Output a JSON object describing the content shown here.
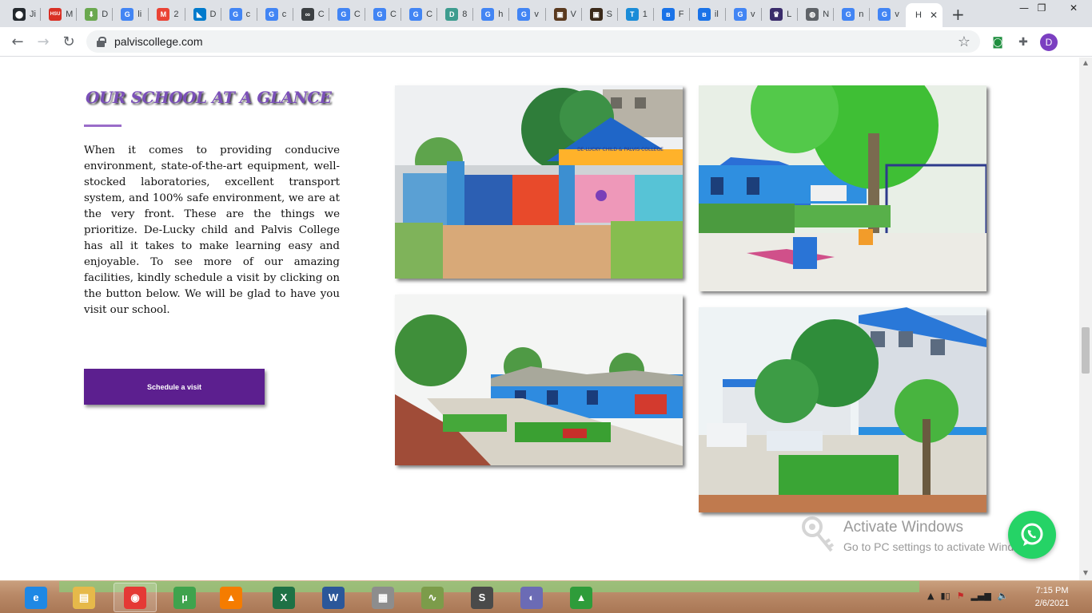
{
  "browser": {
    "tabs": [
      {
        "icon": "github-icon",
        "title": "Ji",
        "color": "#24292e",
        "glyph": "⬤"
      },
      {
        "icon": "hsu-icon",
        "title": "M",
        "color": "#d93025",
        "glyph": "HSU"
      },
      {
        "icon": "download-icon",
        "title": "D",
        "color": "#6aa84f",
        "glyph": "⬇"
      },
      {
        "icon": "google-icon",
        "title": "li",
        "color": "#4285f4",
        "glyph": "G"
      },
      {
        "icon": "gmail-icon",
        "title": "2",
        "color": "#ea4335",
        "glyph": "M"
      },
      {
        "icon": "vscode-icon",
        "title": "D",
        "color": "#007acc",
        "glyph": "◣"
      },
      {
        "icon": "google-icon",
        "title": "c",
        "color": "#4285f4",
        "glyph": "G"
      },
      {
        "icon": "google-icon",
        "title": "c",
        "color": "#4285f4",
        "glyph": "G"
      },
      {
        "icon": "link-icon",
        "title": "C",
        "color": "#3c4043",
        "glyph": "∞"
      },
      {
        "icon": "google-icon",
        "title": "C",
        "color": "#4285f4",
        "glyph": "G"
      },
      {
        "icon": "google-icon",
        "title": "C",
        "color": "#4285f4",
        "glyph": "G"
      },
      {
        "icon": "google-icon",
        "title": "C",
        "color": "#4285f4",
        "glyph": "G"
      },
      {
        "icon": "d-icon",
        "title": "8",
        "color": "#3d9c8f",
        "glyph": "D"
      },
      {
        "icon": "google-icon",
        "title": "h",
        "color": "#4285f4",
        "glyph": "G"
      },
      {
        "icon": "google-icon",
        "title": "v",
        "color": "#4285f4",
        "glyph": "G"
      },
      {
        "icon": "photo-icon",
        "title": "V",
        "color": "#5a3a1f",
        "glyph": "▣"
      },
      {
        "icon": "photo-icon",
        "title": "S",
        "color": "#3b2a1a",
        "glyph": "▣"
      },
      {
        "icon": "t-icon",
        "title": "1",
        "color": "#1a8cd8",
        "glyph": "T"
      },
      {
        "icon": "b-icon",
        "title": "F",
        "color": "#1a73e8",
        "glyph": "ʙ"
      },
      {
        "icon": "b-icon",
        "title": "il",
        "color": "#1a73e8",
        "glyph": "ʙ"
      },
      {
        "icon": "google-icon",
        "title": "v",
        "color": "#4285f4",
        "glyph": "G"
      },
      {
        "icon": "crest-icon",
        "title": "L",
        "color": "#3a2c6b",
        "glyph": "♛"
      },
      {
        "icon": "globe-icon",
        "title": "N",
        "color": "#5f6368",
        "glyph": "◍"
      },
      {
        "icon": "google-icon",
        "title": "n",
        "color": "#4285f4",
        "glyph": "G"
      },
      {
        "icon": "google-icon",
        "title": "v",
        "color": "#4285f4",
        "glyph": "G"
      }
    ],
    "active_tab": {
      "title": "H",
      "close": "✕"
    },
    "new_tab": "+",
    "window_controls": {
      "minimize": "—",
      "restore": "❐",
      "close": "✕"
    },
    "url": "palviscollege.com",
    "profile_initial": "D"
  },
  "page": {
    "heading": "OUR SCHOOL AT A GLANCE",
    "paragraph": "When it comes to providing conducive environment, state-of-the-art equipment, well-stocked laboratories, excellent transport system, and 100% safe environment, we are at the very front. These are the things we prioritize. De-Lucky child and Palvis College has all it takes to make learning easy and enjoyable. To see more of our amazing facilities, kindly schedule a visit by clicking on the button below. We will be glad to have you visit our school.",
    "cta_label": "Schedule a visit",
    "gate_sign": "DE-LUCKY CHILD & PALVIS COLLEGE",
    "brand_purple": "#5c1f8f",
    "accent_purple": "#7b50b8"
  },
  "watermark": {
    "title": "Activate Windows",
    "subtitle": "Go to PC settings to activate Windows."
  },
  "taskbar": {
    "apps": [
      {
        "name": "internet-explorer-icon",
        "glyph": "e",
        "color": "#1e88e5"
      },
      {
        "name": "file-explorer-icon",
        "glyph": "▤",
        "color": "#e6b94a"
      },
      {
        "name": "chrome-icon",
        "glyph": "◉",
        "color": "#e53935"
      },
      {
        "name": "utorrent-icon",
        "glyph": "µ",
        "color": "#3fa34d"
      },
      {
        "name": "vlc-icon",
        "glyph": "▲",
        "color": "#f57c00"
      },
      {
        "name": "excel-icon",
        "glyph": "X",
        "color": "#1e7145"
      },
      {
        "name": "word-icon",
        "glyph": "W",
        "color": "#2b579a"
      },
      {
        "name": "calculator-icon",
        "glyph": "▦",
        "color": "#8d8d8d"
      },
      {
        "name": "graph-editor-icon",
        "glyph": "∿",
        "color": "#7c9c4a"
      },
      {
        "name": "sublime-text-icon",
        "glyph": "S",
        "color": "#4a4a4a"
      },
      {
        "name": "eclipse-icon",
        "glyph": "◐",
        "color": "#6b6bb5"
      },
      {
        "name": "camtasia-icon",
        "glyph": "▲",
        "color": "#2e9c3a"
      }
    ],
    "time": "7:15 PM",
    "date": "2/6/2021"
  }
}
